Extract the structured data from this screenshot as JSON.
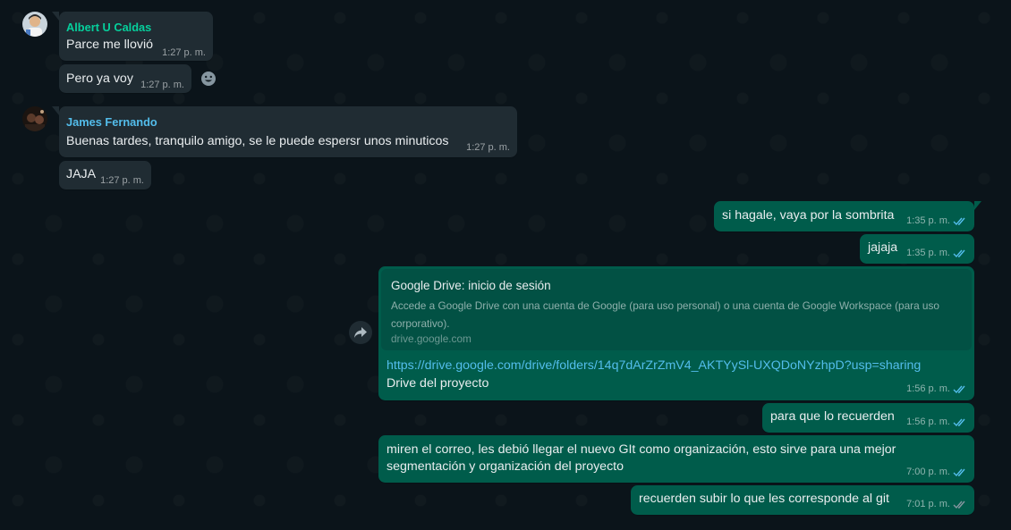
{
  "messages": {
    "m1": {
      "sender": "Albert U Caldas",
      "text": "Parce me llovió",
      "time": "1:27 p. m."
    },
    "m2": {
      "text": "Pero ya voy",
      "time": "1:27 p. m."
    },
    "m3": {
      "sender": "James Fernando",
      "text": "Buenas tardes, tranquilo amigo, se le puede espersr unos minuticos",
      "time": "1:27 p. m."
    },
    "m4": {
      "text": "JAJA",
      "time": "1:27 p. m."
    },
    "m5": {
      "text": "si hagale, vaya por la sombrita",
      "time": "1:35 p. m."
    },
    "m6": {
      "text": "jajaja",
      "time": "1:35 p. m."
    },
    "m7": {
      "preview_title": "Google Drive: inicio de sesión",
      "preview_desc": "Accede a Google Drive con una cuenta de Google (para uso personal) o una cuenta de Google Workspace (para uso corporativo).",
      "preview_domain": "drive.google.com",
      "link": "https://drive.google.com/drive/folders/14q7dArZrZmV4_AKTYySl-UXQDoNYzhpD?usp=sharing",
      "text": "Drive del proyecto",
      "time": "1:56 p. m."
    },
    "m8": {
      "text": "para que lo recuerden",
      "time": "1:56 p. m."
    },
    "m9": {
      "line1": "miren el correo, les debió llegar el nuevo GIt como organización, esto sirve para una mejor",
      "line2": "segmentación y organización del proyecto",
      "time": "7:00 p. m."
    },
    "m10": {
      "text": "recuerden subir lo que les corresponde al git",
      "time": "7:01 p. m."
    }
  },
  "colors": {
    "background": "#0b141a",
    "incoming_bubble": "#202c33",
    "outgoing_bubble": "#005c4b",
    "sender_albert": "#06cf9c",
    "sender_james": "#53bdeb",
    "read_tick": "#53bdeb"
  },
  "icons": [
    "emoji-reaction-icon",
    "forward-icon",
    "double-check-icon"
  ]
}
